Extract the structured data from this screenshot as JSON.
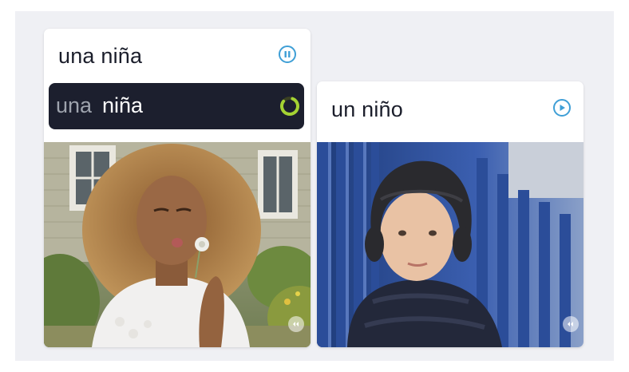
{
  "cards": [
    {
      "word": "una niña",
      "karaoke": {
        "dim": "una",
        "lit": "niña"
      },
      "audio_state": "playing",
      "audio_icon": "pause-icon",
      "image": "girl-blowing-dandelion"
    },
    {
      "word": "un niño",
      "audio_state": "idle",
      "audio_icon": "play-icon",
      "image": "boy-in-winter-cap"
    }
  ],
  "colors": {
    "accent": "#3f9fd6",
    "karaoke_bg": "#1c1f2e",
    "progress": "#a4d233",
    "text": "#1b1e2b",
    "stage_bg": "#eff0f4"
  }
}
